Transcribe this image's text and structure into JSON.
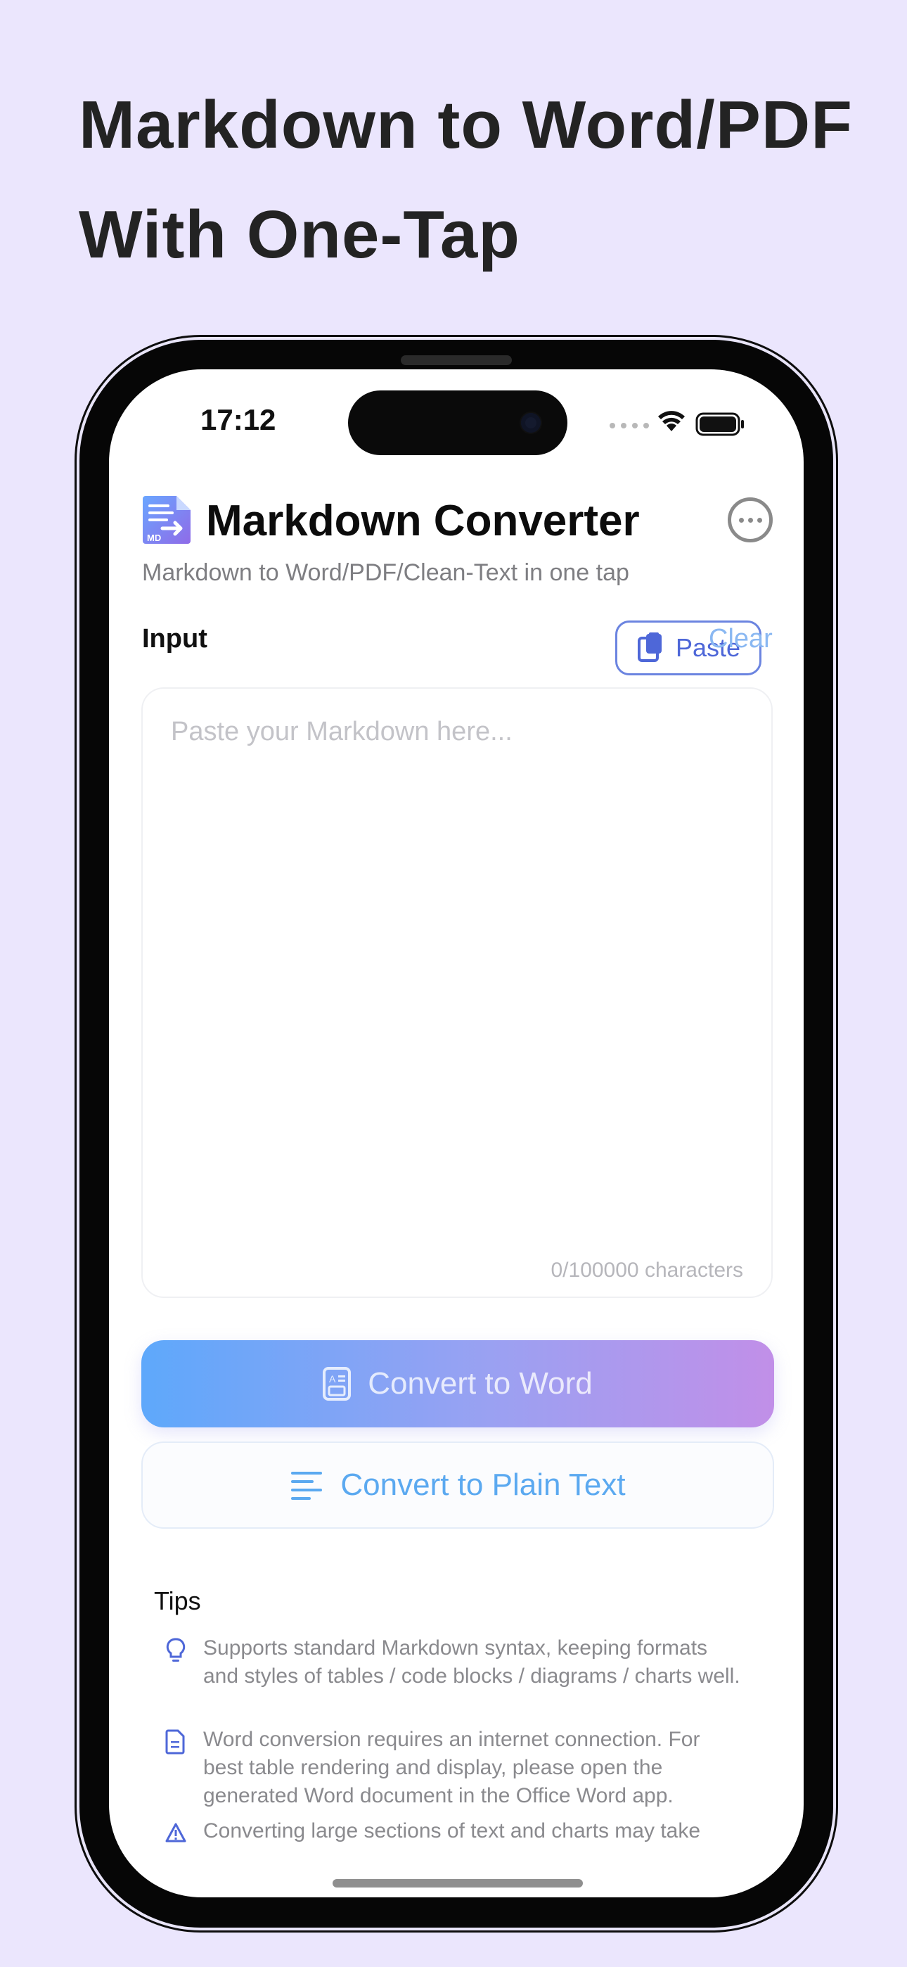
{
  "headline": {
    "line1": "Markdown to Word/PDF",
    "line2": "With One-Tap"
  },
  "status_bar": {
    "time": "17:12"
  },
  "header": {
    "title": "Markdown Converter",
    "subtitle": "Markdown to Word/PDF/Clean-Text in one tap",
    "icon_name": "markdown-doc-icon"
  },
  "input": {
    "label": "Input",
    "paste_label": "Paste",
    "clear_label": "Clear",
    "placeholder": "Paste your Markdown here...",
    "value": "",
    "char_count": "0/100000 characters"
  },
  "actions": {
    "convert_word_label": "Convert to Word",
    "convert_text_label": "Convert to Plain Text"
  },
  "tips": {
    "title": "Tips",
    "items": [
      {
        "icon": "lightbulb-icon",
        "text": "Supports standard Markdown syntax, keeping formats and styles of tables / code blocks / diagrams / charts well."
      },
      {
        "icon": "document-icon",
        "text": "Word conversion requires an internet connection. For best table rendering and display, please open the generated Word document in the Office Word app."
      },
      {
        "icon": "warning-icon",
        "text": "Converting large sections of text and charts may take"
      }
    ]
  },
  "colors": {
    "background": "#ebe6fd",
    "accent_blue": "#4e67d8",
    "link_blue": "#5ba9f0",
    "gradient_start": "#5ea8fb",
    "gradient_end": "#c18fe8"
  }
}
